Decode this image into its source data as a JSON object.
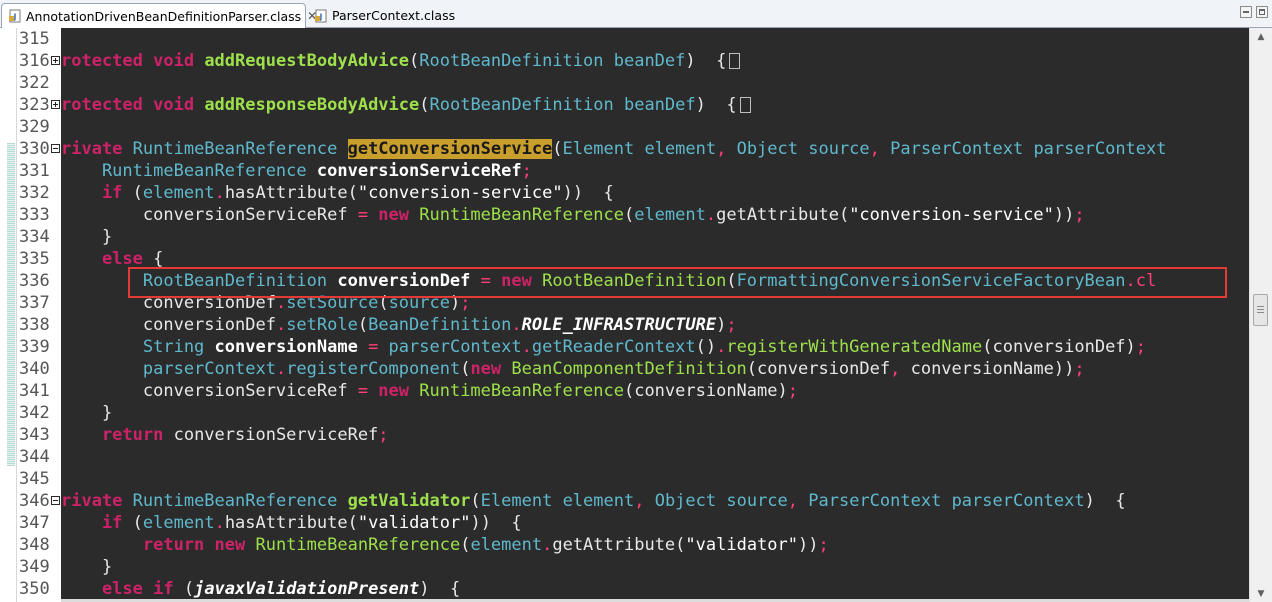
{
  "tabs": [
    {
      "label": "AnnotationDrivenBeanDefinitionParser.class",
      "close": "✕",
      "icon": "class-file-icon"
    },
    {
      "label": "ParserContext.class",
      "icon": "class-file-icon"
    }
  ],
  "code": {
    "highlighted_line": "336",
    "lines": [
      {
        "n": "315",
        "tokens": []
      },
      {
        "n": "316",
        "fold": "plus",
        "tokens": [
          {
            "t": "rotected ",
            "c": "kw"
          },
          {
            "t": "void ",
            "c": "kw"
          },
          {
            "t": "addRequestBodyAdvice",
            "c": "fn"
          },
          {
            "t": "(",
            "c": "pn"
          },
          {
            "t": "RootBeanDefinition ",
            "c": "ty"
          },
          {
            "t": "beanDef",
            "c": "ty"
          },
          {
            "t": ")  {",
            "c": "pn"
          }
        ],
        "foldbox": true
      },
      {
        "n": "322",
        "tokens": []
      },
      {
        "n": "323",
        "fold": "plus",
        "tokens": [
          {
            "t": "rotected ",
            "c": "kw"
          },
          {
            "t": "void ",
            "c": "kw"
          },
          {
            "t": "addResponseBodyAdvice",
            "c": "fn"
          },
          {
            "t": "(",
            "c": "pn"
          },
          {
            "t": "RootBeanDefinition ",
            "c": "ty"
          },
          {
            "t": "beanDef",
            "c": "ty"
          },
          {
            "t": ")  {",
            "c": "pn"
          }
        ],
        "foldbox": true
      },
      {
        "n": "329",
        "tokens": []
      },
      {
        "n": "330",
        "fold": "minus",
        "tokens": [
          {
            "t": "rivate ",
            "c": "kw"
          },
          {
            "t": "RuntimeBeanReference ",
            "c": "ty"
          },
          {
            "t": "getConversionService",
            "c": "fnh"
          },
          {
            "t": "(",
            "c": "pn"
          },
          {
            "t": "Element ",
            "c": "ty"
          },
          {
            "t": "element",
            "c": "ty"
          },
          {
            "t": ", ",
            "c": "op"
          },
          {
            "t": "Object ",
            "c": "ty"
          },
          {
            "t": "source",
            "c": "ty"
          },
          {
            "t": ", ",
            "c": "op"
          },
          {
            "t": "ParserContext ",
            "c": "ty"
          },
          {
            "t": "parserContext",
            "c": "ty"
          }
        ]
      },
      {
        "n": "331",
        "tokens": [
          {
            "t": "    RuntimeBeanReference ",
            "c": "ty"
          },
          {
            "t": "conversionServiceRef",
            "c": "va"
          },
          {
            "t": ";",
            "c": "op"
          }
        ]
      },
      {
        "n": "332",
        "tokens": [
          {
            "t": "    if ",
            "c": "kw"
          },
          {
            "t": "(",
            "c": "pn"
          },
          {
            "t": "element",
            "c": "ty"
          },
          {
            "t": ".",
            "c": "op"
          },
          {
            "t": "hasAttribute",
            "c": "id"
          },
          {
            "t": "(",
            "c": "pn"
          },
          {
            "t": "\"conversion-service\"",
            "c": "st"
          },
          {
            "t": "))  {",
            "c": "pn"
          }
        ]
      },
      {
        "n": "333",
        "tokens": [
          {
            "t": "        conversionServiceRef ",
            "c": "id"
          },
          {
            "t": "= ",
            "c": "op"
          },
          {
            "t": "new ",
            "c": "kw"
          },
          {
            "t": "RuntimeBeanReference",
            "c": "mb"
          },
          {
            "t": "(",
            "c": "pn"
          },
          {
            "t": "element",
            "c": "ty"
          },
          {
            "t": ".",
            "c": "op"
          },
          {
            "t": "getAttribute",
            "c": "id"
          },
          {
            "t": "(",
            "c": "pn"
          },
          {
            "t": "\"conversion-service\"",
            "c": "st"
          },
          {
            "t": "))",
            "c": "pn"
          },
          {
            "t": ";",
            "c": "op"
          }
        ]
      },
      {
        "n": "334",
        "tokens": [
          {
            "t": "    }",
            "c": "pn"
          }
        ]
      },
      {
        "n": "335",
        "tokens": [
          {
            "t": "    else ",
            "c": "kw"
          },
          {
            "t": "{",
            "c": "pn"
          }
        ]
      },
      {
        "n": "336",
        "tokens": [
          {
            "t": "        RootBeanDefinition ",
            "c": "ty"
          },
          {
            "t": "conversionDef ",
            "c": "va"
          },
          {
            "t": "= ",
            "c": "op"
          },
          {
            "t": "new ",
            "c": "kw"
          },
          {
            "t": "RootBeanDefinition",
            "c": "mb"
          },
          {
            "t": "(",
            "c": "pn"
          },
          {
            "t": "FormattingConversionServiceFactoryBean",
            "c": "ty"
          },
          {
            "t": ".cl",
            "c": "op"
          }
        ]
      },
      {
        "n": "337",
        "tokens": [
          {
            "t": "        conversionDef",
            "c": "id"
          },
          {
            "t": ".",
            "c": "op"
          },
          {
            "t": "setSource",
            "c": "ty"
          },
          {
            "t": "(",
            "c": "pn"
          },
          {
            "t": "source",
            "c": "ty"
          },
          {
            "t": ")",
            "c": "pn"
          },
          {
            "t": ";",
            "c": "op"
          }
        ]
      },
      {
        "n": "338",
        "tokens": [
          {
            "t": "        conversionDef",
            "c": "id"
          },
          {
            "t": ".",
            "c": "op"
          },
          {
            "t": "setRole",
            "c": "ty"
          },
          {
            "t": "(",
            "c": "pn"
          },
          {
            "t": "BeanDefinition",
            "c": "ty"
          },
          {
            "t": ".",
            "c": "op"
          },
          {
            "t": "ROLE_INFRASTRUCTURE",
            "c": "co"
          },
          {
            "t": ")",
            "c": "pn"
          },
          {
            "t": ";",
            "c": "op"
          }
        ]
      },
      {
        "n": "339",
        "tokens": [
          {
            "t": "        String ",
            "c": "ty"
          },
          {
            "t": "conversionName ",
            "c": "va"
          },
          {
            "t": "= ",
            "c": "op"
          },
          {
            "t": "parserContext",
            "c": "ty"
          },
          {
            "t": ".",
            "c": "op"
          },
          {
            "t": "getReaderContext",
            "c": "ty"
          },
          {
            "t": "()",
            "c": "pn"
          },
          {
            "t": ".",
            "c": "op"
          },
          {
            "t": "registerWithGeneratedName",
            "c": "mb"
          },
          {
            "t": "(",
            "c": "pn"
          },
          {
            "t": "conversionDef",
            "c": "id"
          },
          {
            "t": ")",
            "c": "pn"
          },
          {
            "t": ";",
            "c": "op"
          }
        ]
      },
      {
        "n": "340",
        "tokens": [
          {
            "t": "        parserContext",
            "c": "ty"
          },
          {
            "t": ".",
            "c": "op"
          },
          {
            "t": "registerComponent",
            "c": "ty"
          },
          {
            "t": "(",
            "c": "pn"
          },
          {
            "t": "new ",
            "c": "kw"
          },
          {
            "t": "BeanComponentDefinition",
            "c": "mb"
          },
          {
            "t": "(",
            "c": "pn"
          },
          {
            "t": "conversionDef",
            "c": "id"
          },
          {
            "t": ", ",
            "c": "op"
          },
          {
            "t": "conversionName",
            "c": "id"
          },
          {
            "t": "))",
            "c": "pn"
          },
          {
            "t": ";",
            "c": "op"
          }
        ]
      },
      {
        "n": "341",
        "tokens": [
          {
            "t": "        conversionServiceRef ",
            "c": "id"
          },
          {
            "t": "= ",
            "c": "op"
          },
          {
            "t": "new ",
            "c": "kw"
          },
          {
            "t": "RuntimeBeanReference",
            "c": "mb"
          },
          {
            "t": "(",
            "c": "pn"
          },
          {
            "t": "conversionName",
            "c": "id"
          },
          {
            "t": ")",
            "c": "pn"
          },
          {
            "t": ";",
            "c": "op"
          }
        ]
      },
      {
        "n": "342",
        "tokens": [
          {
            "t": "    }",
            "c": "pn"
          }
        ]
      },
      {
        "n": "343",
        "tokens": [
          {
            "t": "    return ",
            "c": "kw"
          },
          {
            "t": "conversionServiceRef",
            "c": "id"
          },
          {
            "t": ";",
            "c": "op"
          }
        ]
      },
      {
        "n": "344",
        "tokens": []
      },
      {
        "n": "345",
        "tokens": []
      },
      {
        "n": "346",
        "fold": "minus",
        "tokens": [
          {
            "t": "rivate ",
            "c": "kw"
          },
          {
            "t": "RuntimeBeanReference ",
            "c": "ty"
          },
          {
            "t": "getValidator",
            "c": "fn"
          },
          {
            "t": "(",
            "c": "pn"
          },
          {
            "t": "Element ",
            "c": "ty"
          },
          {
            "t": "element",
            "c": "ty"
          },
          {
            "t": ", ",
            "c": "op"
          },
          {
            "t": "Object ",
            "c": "ty"
          },
          {
            "t": "source",
            "c": "ty"
          },
          {
            "t": ", ",
            "c": "op"
          },
          {
            "t": "ParserContext ",
            "c": "ty"
          },
          {
            "t": "parserContext",
            "c": "ty"
          },
          {
            "t": ")  {",
            "c": "pn"
          }
        ]
      },
      {
        "n": "347",
        "tokens": [
          {
            "t": "    if ",
            "c": "kw"
          },
          {
            "t": "(",
            "c": "pn"
          },
          {
            "t": "element",
            "c": "ty"
          },
          {
            "t": ".",
            "c": "op"
          },
          {
            "t": "hasAttribute",
            "c": "id"
          },
          {
            "t": "(",
            "c": "pn"
          },
          {
            "t": "\"validator\"",
            "c": "st"
          },
          {
            "t": "))  {",
            "c": "pn"
          }
        ]
      },
      {
        "n": "348",
        "tokens": [
          {
            "t": "        return ",
            "c": "kw"
          },
          {
            "t": "new ",
            "c": "kw"
          },
          {
            "t": "RuntimeBeanReference",
            "c": "mb"
          },
          {
            "t": "(",
            "c": "pn"
          },
          {
            "t": "element",
            "c": "ty"
          },
          {
            "t": ".",
            "c": "op"
          },
          {
            "t": "getAttribute",
            "c": "id"
          },
          {
            "t": "(",
            "c": "pn"
          },
          {
            "t": "\"validator\"",
            "c": "st"
          },
          {
            "t": "))",
            "c": "pn"
          },
          {
            "t": ";",
            "c": "op"
          }
        ]
      },
      {
        "n": "349",
        "tokens": [
          {
            "t": "    }",
            "c": "pn"
          }
        ]
      },
      {
        "n": "350",
        "tokens": [
          {
            "t": "    else if ",
            "c": "kw"
          },
          {
            "t": "(",
            "c": "pn"
          },
          {
            "t": "javaxValidationPresent",
            "c": "co"
          },
          {
            "t": ")  {",
            "c": "pn"
          }
        ]
      }
    ]
  }
}
